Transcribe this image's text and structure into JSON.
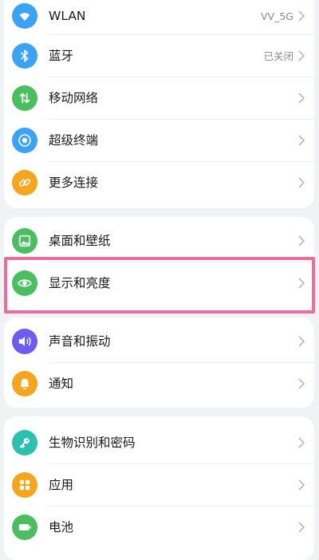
{
  "settings": {
    "connectivity": [
      {
        "id": "wlan",
        "label": "WLAN",
        "value": "VV_5G",
        "icon": "wifi-icon",
        "color": "#3aa3f6"
      },
      {
        "id": "bluetooth",
        "label": "蓝牙",
        "value": "已关闭",
        "icon": "bluetooth-icon",
        "color": "#3aa3f6"
      },
      {
        "id": "mobile-network",
        "label": "移动网络",
        "value": "",
        "icon": "mobile-data-icon",
        "color": "#4bbf5f"
      },
      {
        "id": "super-terminal",
        "label": "超级终端",
        "value": "",
        "icon": "super-terminal-icon",
        "color": "#3aa3f6"
      },
      {
        "id": "more-connections",
        "label": "更多连接",
        "value": "",
        "icon": "link-icon",
        "color": "#f7a51c"
      }
    ],
    "display": [
      {
        "id": "desktop-wallpaper",
        "label": "桌面和壁纸",
        "value": "",
        "icon": "wallpaper-icon",
        "color": "#4bbf5f"
      },
      {
        "id": "display-brightness",
        "label": "显示和亮度",
        "value": "",
        "icon": "eye-icon",
        "color": "#4bbf5f"
      }
    ],
    "sound": [
      {
        "id": "sound-vibration",
        "label": "声音和振动",
        "value": "",
        "icon": "speaker-icon",
        "color": "#6c5cf2"
      },
      {
        "id": "notifications",
        "label": "通知",
        "value": "",
        "icon": "bell-icon",
        "color": "#f7a51c"
      }
    ],
    "security": [
      {
        "id": "biometrics-password",
        "label": "生物识别和密码",
        "value": "",
        "icon": "key-icon",
        "color": "#2bc1ae"
      },
      {
        "id": "apps",
        "label": "应用",
        "value": "",
        "icon": "apps-grid-icon",
        "color": "#f7a51c"
      },
      {
        "id": "battery",
        "label": "电池",
        "value": "",
        "icon": "battery-icon",
        "color": "#4bbf5f"
      }
    ]
  },
  "highlight_color": "#ee6c9a"
}
